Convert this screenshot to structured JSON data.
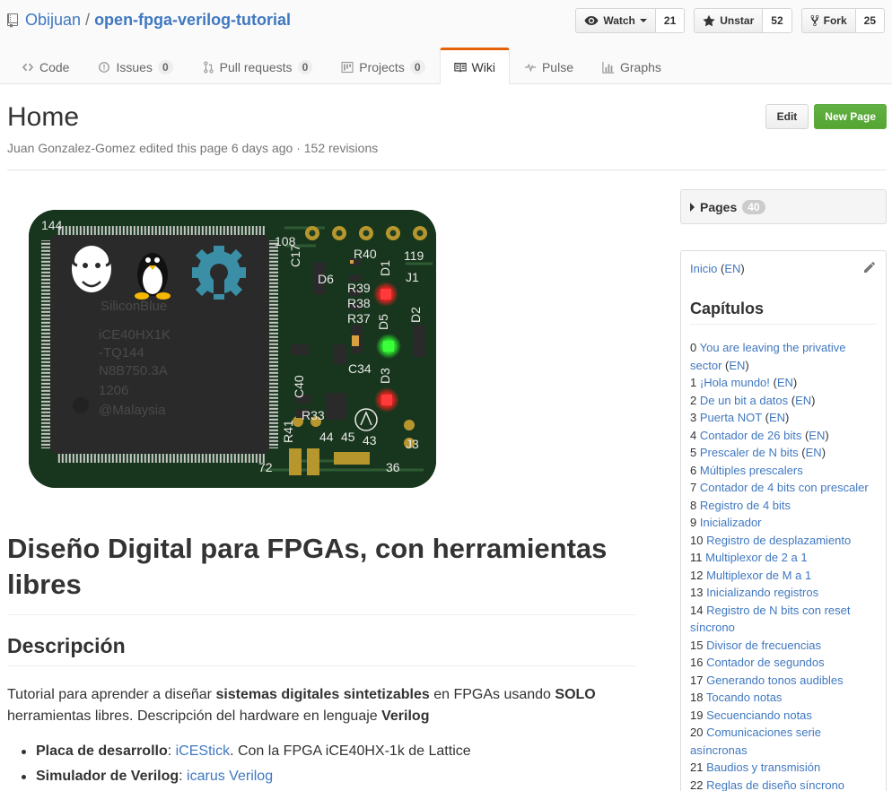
{
  "repo": {
    "owner": "Obijuan",
    "separator": "/",
    "name": "open-fpga-verilog-tutorial",
    "actions": [
      {
        "icon": "eye-icon",
        "label": "Watch",
        "count": "21",
        "dropdown": true
      },
      {
        "icon": "star-icon",
        "label": "Unstar",
        "count": "52",
        "dropdown": false
      },
      {
        "icon": "fork-icon",
        "label": "Fork",
        "count": "25",
        "dropdown": false
      }
    ],
    "nav": [
      {
        "icon": "code-icon",
        "label": "Code",
        "counter": ""
      },
      {
        "icon": "issue-icon",
        "label": "Issues",
        "counter": "0"
      },
      {
        "icon": "pull-request-icon",
        "label": "Pull requests",
        "counter": "0"
      },
      {
        "icon": "project-icon",
        "label": "Projects",
        "counter": "0"
      },
      {
        "icon": "book-icon",
        "label": "Wiki",
        "counter": "",
        "selected": true
      },
      {
        "icon": "pulse-icon",
        "label": "Pulse",
        "counter": ""
      },
      {
        "icon": "graph-icon",
        "label": "Graphs",
        "counter": ""
      }
    ]
  },
  "wiki": {
    "title": "Home",
    "meta": "Juan Gonzalez-Gomez edited this page 6 days ago · 152 revisions",
    "edit_label": "Edit",
    "new_page_label": "New Page",
    "heading": "Diseño Digital para FPGAs, con herramientas libres",
    "subheading": "Descripción",
    "intro": {
      "t1": "Tutorial para aprender a diseñar ",
      "b1": "sistemas digitales sintetizables",
      "t2": " en FPGAs usando ",
      "b2": "SOLO",
      "t3": " herramientas libres. Descripción del hardware en lenguaje ",
      "b3": "Verilog"
    },
    "bullets": [
      {
        "bold": "Placa de desarrollo",
        "sep": ": ",
        "link": "iCEStick",
        "rest": ". Con la FPGA iCE40HX-1k de Lattice"
      },
      {
        "bold": "Simulador de Verilog",
        "sep": ": ",
        "link": "icarus Verilog",
        "rest": ""
      }
    ]
  },
  "sidebar": {
    "pages_label": "Pages",
    "pages_count": "40",
    "inicio_link": "Inicio",
    "inicio_en": "EN",
    "chapters_title": "Capítulos",
    "chapters": [
      {
        "num": "0",
        "title": "You are leaving the privative sector",
        "en": true
      },
      {
        "num": "1",
        "title": "¡Hola mundo!",
        "en": true
      },
      {
        "num": "2",
        "title": "De un bit a datos",
        "en": true
      },
      {
        "num": "3",
        "title": "Puerta NOT",
        "en": true
      },
      {
        "num": "4",
        "title": "Contador de 26 bits",
        "en": true
      },
      {
        "num": "5",
        "title": "Prescaler de N bits",
        "en": true
      },
      {
        "num": "6",
        "title": "Múltiples prescalers",
        "en": false
      },
      {
        "num": "7",
        "title": "Contador de 4 bits con prescaler",
        "en": false
      },
      {
        "num": "8",
        "title": "Registro de 4 bits",
        "en": false
      },
      {
        "num": "9",
        "title": "Inicializador",
        "en": false
      },
      {
        "num": "10",
        "title": "Registro de desplazamiento",
        "en": false
      },
      {
        "num": "11",
        "title": "Multiplexor de 2 a 1",
        "en": false
      },
      {
        "num": "12",
        "title": "Multiplexor de M a 1",
        "en": false
      },
      {
        "num": "13",
        "title": "Inicializando registros",
        "en": false
      },
      {
        "num": "14",
        "title": "Registro de N bits con reset síncrono",
        "en": false
      },
      {
        "num": "15",
        "title": "Divisor de frecuencias",
        "en": false
      },
      {
        "num": "16",
        "title": "Contador de segundos",
        "en": false
      },
      {
        "num": "17",
        "title": "Generando tonos audibles",
        "en": false
      },
      {
        "num": "18",
        "title": "Tocando notas",
        "en": false
      },
      {
        "num": "19",
        "title": "Secuenciando notas",
        "en": false
      },
      {
        "num": "20",
        "title": "Comunicaciones serie asíncronas",
        "en": false
      },
      {
        "num": "21",
        "title": "Baudios y transmisión",
        "en": false
      },
      {
        "num": "22",
        "title": "Reglas de diseño síncrono",
        "en": false
      }
    ],
    "en_label": "EN"
  },
  "board_image": {
    "chip_text": [
      "SiliconBlue",
      "iCE40HX1K",
      "-TQ144",
      "N8B750.3A",
      "1206",
      "@Malaysia"
    ],
    "pcb_labels": [
      "144",
      "108",
      "R40",
      "D1",
      "J1",
      "119",
      "R39",
      "R38",
      "R37",
      "D6",
      "D5",
      "D2",
      "D3",
      "C34",
      "C40",
      "R33",
      "R41",
      "44",
      "45",
      "43",
      "J3",
      "72",
      "36",
      "C17"
    ],
    "colors": {
      "pcb": "#1c3a22",
      "chip": "#2a2a2a",
      "led_red": "#ff2a2a",
      "led_green": "#3cff3c",
      "gear": "#3a8fa6"
    }
  }
}
